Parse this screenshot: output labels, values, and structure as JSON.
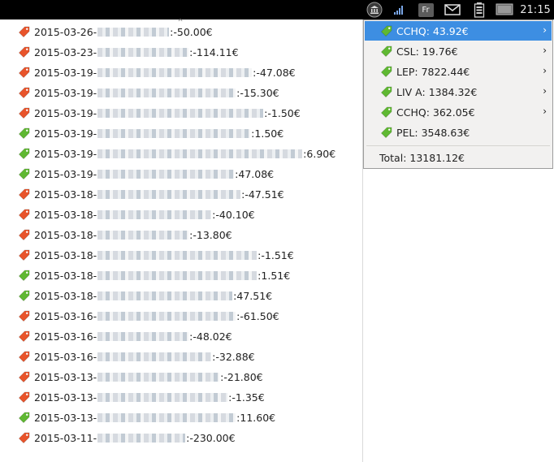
{
  "topbar": {
    "clock": "21:15",
    "keyboard_layout": "Fr",
    "icons": [
      "bank-icon",
      "network-signal-icon",
      "keyboard-layout-icon",
      "mail-icon",
      "battery-icon",
      "display-icon"
    ]
  },
  "transactions": [
    {
      "date": "2015-03-26",
      "amount": "-50.00€",
      "kind": "debit"
    },
    {
      "date": "2015-03-23",
      "amount": "-114.11€",
      "kind": "debit"
    },
    {
      "date": "2015-03-19",
      "amount": "-47.08€",
      "kind": "debit"
    },
    {
      "date": "2015-03-19",
      "amount": "-15.30€",
      "kind": "debit"
    },
    {
      "date": "2015-03-19",
      "amount": "-1.50€",
      "kind": "debit"
    },
    {
      "date": "2015-03-19",
      "amount": "1.50€",
      "kind": "credit"
    },
    {
      "date": "2015-03-19",
      "amount": "6.90€",
      "kind": "credit"
    },
    {
      "date": "2015-03-19",
      "amount": "47.08€",
      "kind": "credit"
    },
    {
      "date": "2015-03-18",
      "amount": "-47.51€",
      "kind": "debit"
    },
    {
      "date": "2015-03-18",
      "amount": "-40.10€",
      "kind": "debit"
    },
    {
      "date": "2015-03-18",
      "amount": "-13.80€",
      "kind": "debit"
    },
    {
      "date": "2015-03-18",
      "amount": "-1.51€",
      "kind": "debit"
    },
    {
      "date": "2015-03-18",
      "amount": "1.51€",
      "kind": "credit"
    },
    {
      "date": "2015-03-18",
      "amount": "47.51€",
      "kind": "credit"
    },
    {
      "date": "2015-03-16",
      "amount": "-61.50€",
      "kind": "debit"
    },
    {
      "date": "2015-03-16",
      "amount": "-48.02€",
      "kind": "debit"
    },
    {
      "date": "2015-03-16",
      "amount": "-32.88€",
      "kind": "debit"
    },
    {
      "date": "2015-03-13",
      "amount": "-21.80€",
      "kind": "debit"
    },
    {
      "date": "2015-03-13",
      "amount": "-1.35€",
      "kind": "debit"
    },
    {
      "date": "2015-03-13",
      "amount": "11.60€",
      "kind": "credit"
    },
    {
      "date": "2015-03-11",
      "amount": "-230.00€",
      "kind": "debit"
    }
  ],
  "accounts": [
    {
      "label": "CCHQ: 43.92€",
      "submenu": true,
      "active": true
    },
    {
      "label": "CSL: 19.76€",
      "submenu": true,
      "active": false
    },
    {
      "label": "LEP: 7822.44€",
      "submenu": true,
      "active": false
    },
    {
      "label": "LIV A: 1384.32€",
      "submenu": true,
      "active": false
    },
    {
      "label": "CCHQ: 362.05€",
      "submenu": true,
      "active": false
    },
    {
      "label": "PEL: 3548.63€",
      "submenu": false,
      "active": false
    }
  ],
  "total_label": "Total: 13181.12€",
  "colors": {
    "debit_tag": "#e8542b",
    "credit_tag": "#5fb832",
    "highlight": "#3d8ee2",
    "panel": "#000000"
  }
}
